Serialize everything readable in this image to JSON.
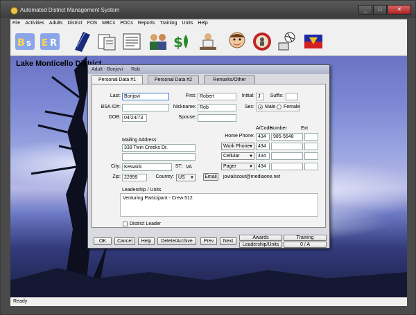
{
  "window": {
    "title": "Automated District Management System",
    "minimize": "_",
    "maximize": "□",
    "close": "✕"
  },
  "menu": [
    "File",
    "Activities",
    "Adults",
    "District",
    "FOS",
    "MBCs",
    "POCs",
    "Reports",
    "Training",
    "Units",
    "Help"
  ],
  "desktop_caption": "Lake Monticello District",
  "status": "Ready",
  "dialog": {
    "title_prefix": "Adult - Bonjovi",
    "title_name": "Rob",
    "tabs": [
      "Personal Data #1",
      "Personal Data #2",
      "Remarks/Other"
    ],
    "labels": {
      "last": "Last:",
      "bsa_id": "BSA ID#:",
      "dob": "DOB:",
      "first": "First:",
      "nickname": "Nickname:",
      "spouse": "Spouse:",
      "initial": "Initial:",
      "suffix": "Suffix:",
      "sex": "Sex:",
      "male": "Male",
      "female": "Female",
      "mailing": "Mailing Address:",
      "city": "City:",
      "st": "ST:",
      "zip": "Zip:",
      "country": "Country:",
      "area_code": "A/Code",
      "number": "Number",
      "ext": "Ext",
      "home_phone": "Home Phone:",
      "email_btn": "Email",
      "leadership": "Leadership / Units",
      "district_leader": "District Leader"
    },
    "values": {
      "last": "Bonjovi",
      "bsa_id": "",
      "dob": "04/24/73",
      "first": "Robert",
      "nickname": "Rob",
      "spouse": "",
      "initial": "J",
      "suffix": "",
      "address1": "339 Twin Creeks Dr.",
      "address2": "",
      "city": "Keswick",
      "st": "VA",
      "zip": "22899",
      "country": "US",
      "home_ac": "434",
      "home_num": "985-5648",
      "work_label": "Work Phone",
      "work_ac": "434",
      "cell_label": "Cellular",
      "cell_ac": "434",
      "pager_label": "Pager",
      "pager_ac": "434",
      "email": "jovialscout@mediaone.net",
      "leadership_text": "Venturing Participant - Crew 512",
      "sex": "Male"
    },
    "buttons": {
      "ok": "OK",
      "cancel": "Cancel",
      "help": "Help",
      "delete": "Delete/Archive",
      "prev": "Prev",
      "next": "Next",
      "awards": "Awards",
      "training": "Training",
      "leadership_units": "Leadership/Units",
      "counter": "0 / A"
    }
  }
}
